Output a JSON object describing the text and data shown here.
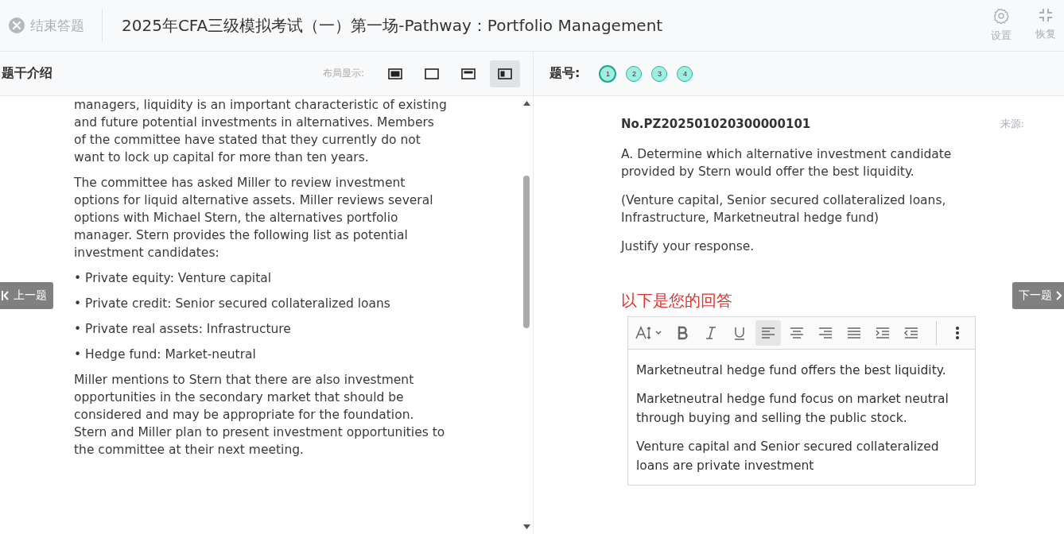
{
  "header": {
    "end_button": "结束答题",
    "title": "2025年CFA三级模拟考试（一）第一场-Pathway：Portfolio Management",
    "actions": [
      {
        "kind": "settings",
        "label": "设置"
      },
      {
        "kind": "restore",
        "label": "恢复"
      }
    ]
  },
  "left_panel": {
    "title": "题干介绍",
    "layout_label": "布局显示:",
    "layouts": [
      {
        "kind": "full",
        "selected": false
      },
      {
        "kind": "empty",
        "selected": false
      },
      {
        "kind": "top",
        "selected": false
      },
      {
        "kind": "left",
        "selected": true
      }
    ],
    "paragraphs": [
      "managers, liquidity is an important characteristic of existing and future potential investments in alternatives. Members of the committee have stated that they currently do not want to lock up capital for more than ten years.",
      "The committee has asked Miller to review investment options for liquid alternative assets. Miller reviews several options with Michael Stern, the alternatives portfolio manager. Stern provides the following list as potential investment candidates:",
      "• Private equity: Venture capital",
      "• Private credit: Senior secured collateralized loans",
      "• Private real assets: Infrastructure",
      "• Hedge fund: Market-neutral",
      "Miller mentions to Stern that there are also investment opportunities in the secondary market that should be considered and may be appropriate for the foundation. Stern and Miller plan to present investment opportunities to the committee at their next meeting."
    ]
  },
  "prev_button": "上一题",
  "next_button": "下一题",
  "right_panel": {
    "question_label": "题号:",
    "questions": [
      {
        "label": "1",
        "selected": true
      },
      {
        "label": "2",
        "selected": false
      },
      {
        "label": "3",
        "selected": false
      },
      {
        "label": "4",
        "selected": false
      }
    ],
    "question_id": "No.PZ202501020300000101",
    "source_label": "来源:",
    "paragraphs": [
      "A. Determine which alternative investment candidate provided by Stern would offer the best liquidity.",
      "(Venture capital, Senior secured collateralized loans, Infrastructure, Marketneutral hedge fund)",
      "Justify your response."
    ],
    "answer_heading": "以下是您的回答",
    "toolbar": [
      {
        "kind": "font-size",
        "selected": false
      },
      {
        "kind": "bold",
        "selected": false
      },
      {
        "kind": "italic",
        "selected": false
      },
      {
        "kind": "underline",
        "selected": false
      },
      {
        "kind": "align-left",
        "selected": true
      },
      {
        "kind": "align-center",
        "selected": false
      },
      {
        "kind": "align-right",
        "selected": false
      },
      {
        "kind": "justify",
        "selected": false
      },
      {
        "kind": "indent",
        "selected": false
      },
      {
        "kind": "outdent",
        "selected": false
      }
    ],
    "answer": [
      "Marketneutral hedge fund offers the best liquidity.",
      "Marketneutral hedge fund focus on market neutral through buying and selling the public stock.",
      "Venture capital and  Senior secured collateralized loans are private investment"
    ]
  }
}
